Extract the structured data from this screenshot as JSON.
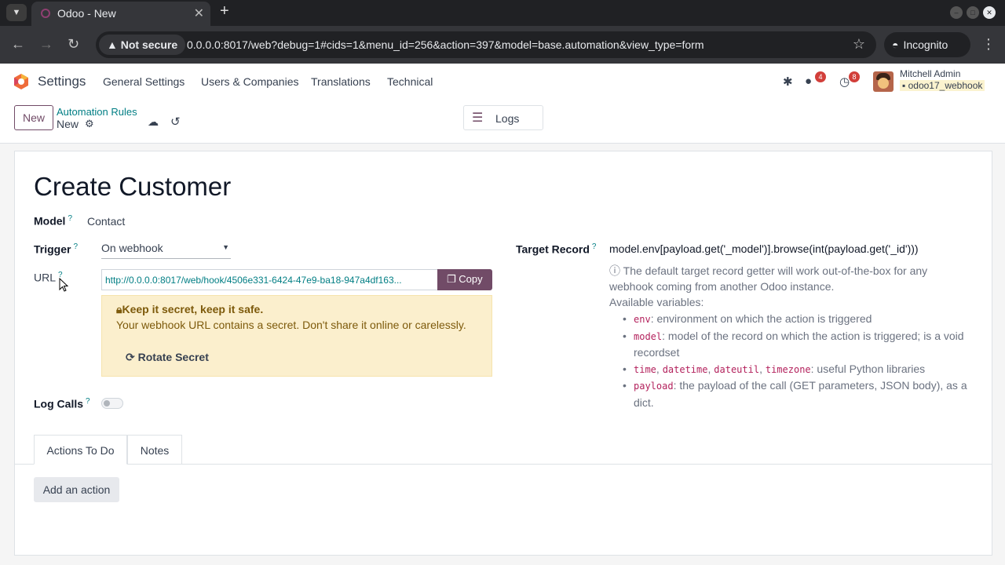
{
  "browser": {
    "tab_title": "Odoo - New",
    "security_label": "Not secure",
    "url": "0.0.0.0:8017/web?debug=1#cids=1&menu_id=256&action=397&model=base.automation&view_type=form",
    "incognito_label": "Incognito"
  },
  "navbar": {
    "app_name": "Settings",
    "menu": [
      "General Settings",
      "Users & Companies",
      "Translations",
      "Technical"
    ],
    "messages_count": "4",
    "activities_count": "8",
    "user_name": "Mitchell Admin",
    "db_name": "odoo17_webhook"
  },
  "control_panel": {
    "new_button": "New",
    "breadcrumb_parent": "Automation Rules",
    "breadcrumb_current": "New",
    "logs_button": "Logs"
  },
  "form": {
    "title": "Create Customer",
    "model_label": "Model",
    "model_value": "Contact",
    "trigger_label": "Trigger",
    "trigger_value": "On webhook",
    "url_label": "URL",
    "url_value": "http://0.0.0.0:8017/web/hook/4506e331-6424-47e9-ba18-947a4df163...",
    "copy_button": "Copy",
    "warning_title": "Keep it secret, keep it safe.",
    "warning_text": "Your webhook URL contains a secret. Don't share it online or carelessly.",
    "rotate_button": "Rotate Secret",
    "log_calls_label": "Log Calls",
    "log_calls_enabled": false,
    "target_label": "Target Record",
    "target_value": "model.env[payload.get('_model')].browse(int(payload.get('_id')))",
    "help_line1": "The default target record getter will work out-of-the-box for any",
    "help_line2": "webhook coming from another Odoo instance.",
    "help_vars": "Available variables:",
    "variables": {
      "env": "env",
      "env_desc": ": environment on which the action is triggered",
      "model": "model",
      "model_desc1": ": model of the record on which the action is triggered; is a void",
      "model_desc2": "recordset",
      "time": "time",
      "datetime": "datetime",
      "dateutil": "dateutil",
      "timezone": "timezone",
      "libs_desc": ": useful Python libraries",
      "payload": "payload",
      "payload_desc1": ": the payload of the call (GET parameters, JSON body), as a",
      "payload_desc2": "dict."
    },
    "tabs": [
      "Actions To Do",
      "Notes"
    ],
    "add_action_button": "Add an action"
  },
  "colors": {
    "brand": "#714b67",
    "link": "#017e84",
    "warning_bg": "#fbefcd"
  }
}
